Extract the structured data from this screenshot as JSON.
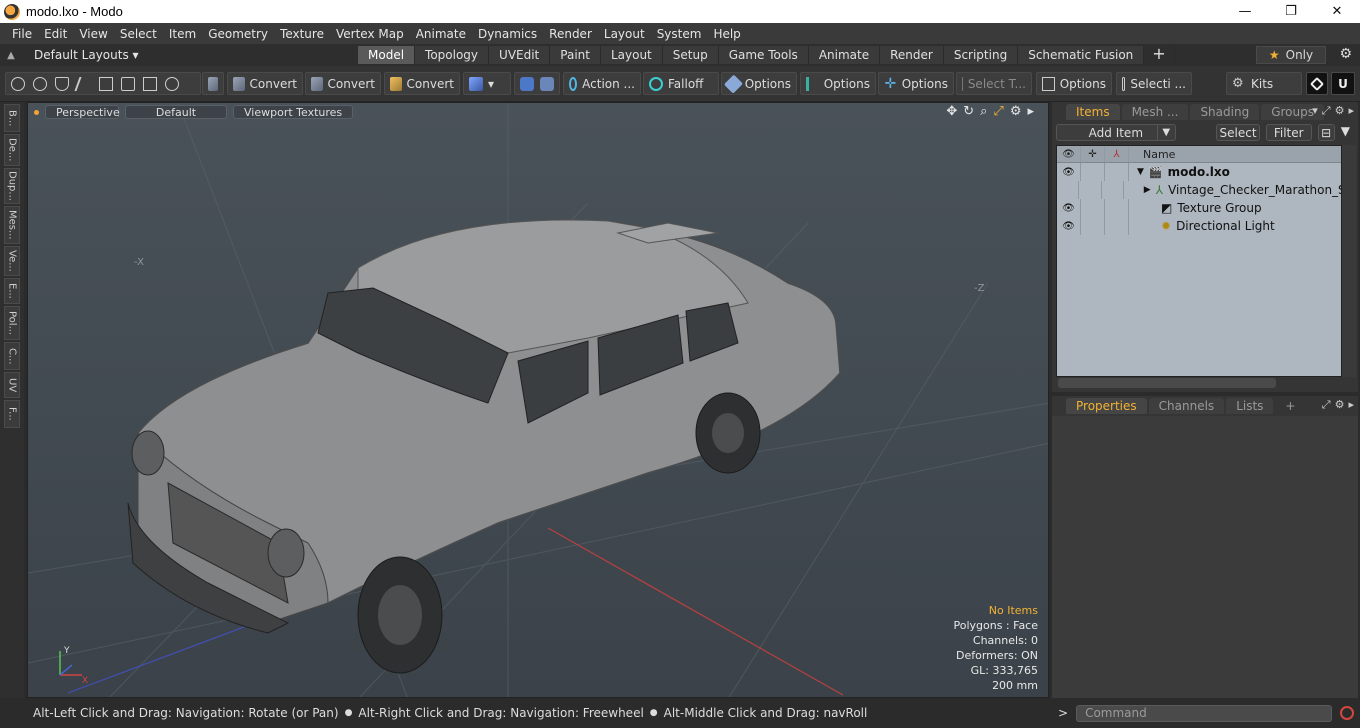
{
  "window": {
    "title": "modo.lxo - Modo",
    "minimize": "—",
    "maximize": "❐",
    "close": "✕"
  },
  "menu": [
    "File",
    "Edit",
    "View",
    "Select",
    "Item",
    "Geometry",
    "Texture",
    "Vertex Map",
    "Animate",
    "Dynamics",
    "Render",
    "Layout",
    "System",
    "Help"
  ],
  "layout_bar": {
    "layouts_label": "Default Layouts ▾",
    "tabs": [
      "Model",
      "Topology",
      "UVEdit",
      "Paint",
      "Layout",
      "Setup",
      "Game Tools",
      "Animate",
      "Render",
      "Scripting",
      "Schematic Fusion"
    ],
    "active_tab": "Model",
    "plus": "+",
    "only_label": "Only",
    "star": "★",
    "gear": "⚙"
  },
  "toolbar": {
    "convert1": "Convert",
    "convert2": "Convert",
    "convert3": "Convert",
    "action": "Action ...",
    "falloff": "Falloff",
    "options1": "Options",
    "options2": "Options",
    "options3": "Options",
    "select_t": "Select T...",
    "options4": "Options",
    "selecti": "Selecti ...",
    "kits": "Kits"
  },
  "left_tabs": [
    "B...",
    "De...",
    "Dup...",
    "Mes...",
    "Ve...",
    "E...",
    "Pol...",
    "C...",
    "UV",
    "F..."
  ],
  "viewport": {
    "view": "Perspective",
    "shading": "Default",
    "textures": "Viewport Textures",
    "stats": {
      "no_items": "No Items",
      "polygons": "Polygons : Face",
      "channels": "Channels: 0",
      "deformers": "Deformers: ON",
      "gl": "GL: 333,765",
      "scale": "200 mm"
    },
    "axis_labels": {
      "y": "Y",
      "x": "X"
    }
  },
  "status": {
    "hint1": "Alt-Left Click and Drag: Navigation: Rotate (or Pan)",
    "hint2": "Alt-Right Click and Drag: Navigation: Freewheel",
    "hint3": "Alt-Middle Click and Drag: navRoll"
  },
  "items_panel": {
    "tabs": [
      "Items",
      "Mesh ...",
      "Shading",
      "Groups"
    ],
    "active_tab": "Items",
    "add_item": "Add Item",
    "select": "Select",
    "filter": "Filter",
    "column_name": "Name",
    "tree": [
      {
        "name": "modo.lxo",
        "bold": true,
        "eye": true,
        "icon": "scene-icon"
      },
      {
        "name": "Vintage_Checker_Marathon_S...",
        "bold": false,
        "eye": false,
        "icon": "mesh-icon"
      },
      {
        "name": "Texture Group",
        "bold": false,
        "eye": true,
        "icon": "texture-group-icon"
      },
      {
        "name": "Directional Light",
        "bold": false,
        "eye": true,
        "icon": "light-icon"
      }
    ]
  },
  "properties_panel": {
    "tabs": [
      "Properties",
      "Channels",
      "Lists"
    ],
    "active_tab": "Properties",
    "plus": "+"
  },
  "command": {
    "caret": ">",
    "placeholder": "Command"
  },
  "colors": {
    "accent": "#f2b233",
    "viewport_bg": "#454d54",
    "tree_bg": "#aeb7bf"
  }
}
